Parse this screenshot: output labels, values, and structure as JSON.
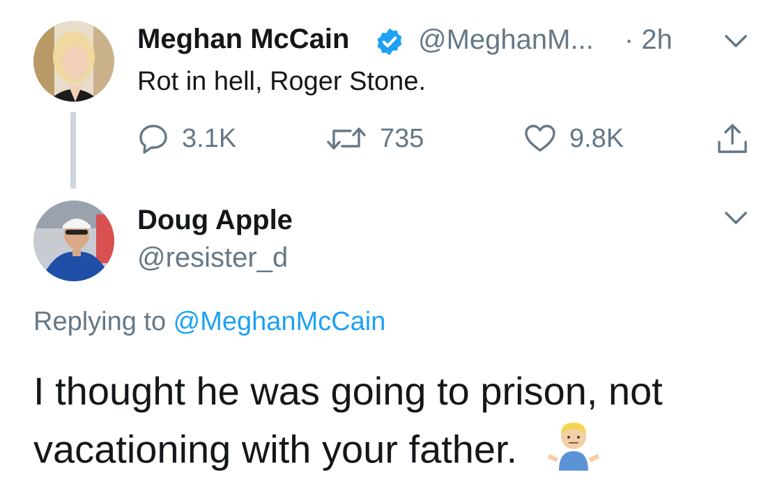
{
  "original_tweet": {
    "display_name": "Meghan McCain",
    "handle": "@MeghanM...",
    "time": "· 2h",
    "text": "Rot in hell, Roger Stone.",
    "verified": true,
    "actions": {
      "replies": "3.1K",
      "retweets": "735",
      "likes": "9.8K"
    }
  },
  "reply_tweet": {
    "display_name": "Doug Apple",
    "handle": "@resister_d",
    "replying_prefix": "Replying to ",
    "replying_to": "@MeghanMcCain",
    "text": "I thought he was going to prison, not vacationing with your father.",
    "emoji": "🤷🏼‍♂️"
  },
  "colors": {
    "accent": "#1da1f2",
    "secondary_text": "#657786",
    "primary_text": "#14171a",
    "thread_line": "#ccd6dd"
  },
  "icons": [
    "verified-badge-icon",
    "chevron-down-icon",
    "reply-icon",
    "retweet-icon",
    "like-icon",
    "share-icon"
  ]
}
